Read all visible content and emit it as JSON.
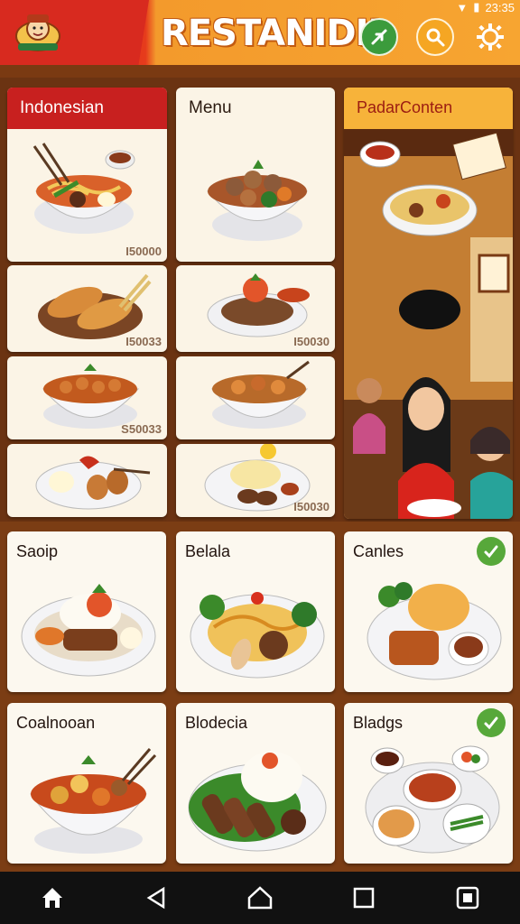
{
  "header": {
    "title": "RESTANIDII",
    "status_time": "23:35",
    "colors": {
      "red": "#d82a1f",
      "orange": "#f7a531",
      "green": "#3b9b3c"
    },
    "icons": [
      "logo-icon",
      "leaf-icon",
      "search-icon",
      "gear-icon"
    ]
  },
  "top_cards": [
    {
      "title": "Indonesian",
      "price": ""
    },
    {
      "title": "Menu",
      "price": ""
    },
    {
      "title": "PadarConten",
      "price": ""
    },
    {
      "title": "",
      "price": "I50000"
    },
    {
      "title": "",
      "price": "I50033"
    },
    {
      "title": "",
      "price": "I50030"
    },
    {
      "title": "",
      "price": "S50033"
    },
    {
      "title": "",
      "price": ""
    },
    {
      "title": "",
      "price": "I50030"
    }
  ],
  "bottom_cards": [
    {
      "title": "Saoip",
      "checked": false
    },
    {
      "title": "Belala",
      "checked": false
    },
    {
      "title": "Canles",
      "checked": true
    },
    {
      "title": "Coalnooan",
      "checked": false
    },
    {
      "title": "Blodecia",
      "checked": false
    },
    {
      "title": "Bladgs",
      "checked": true
    }
  ],
  "navbar": {
    "icons": [
      "home-icon",
      "back-icon",
      "home-circle-icon",
      "recents-icon",
      "screenshot-icon"
    ]
  }
}
